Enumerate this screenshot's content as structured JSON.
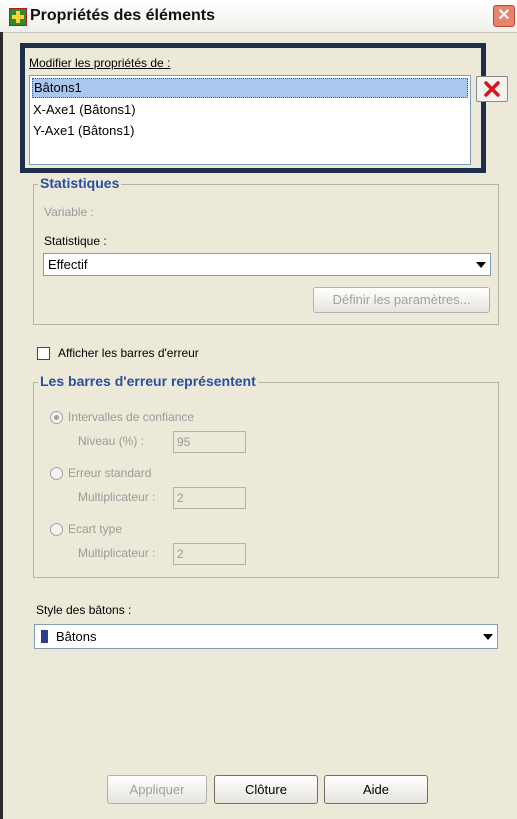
{
  "window": {
    "title": "Propriétés des éléments",
    "close_glyph": "✕"
  },
  "modify": {
    "label": "Modifier les propriétés de :",
    "items": [
      "Bâtons1",
      "X-Axe1 (Bâtons1)",
      "Y-Axe1 (Bâtons1)"
    ],
    "selected_index": 0
  },
  "statistics": {
    "legend": "Statistiques",
    "variable_label": "Variable :",
    "statistic_label": "Statistique :",
    "statistic_value": "Effectif",
    "params_button": "Définir les paramètres..."
  },
  "error_bars": {
    "checkbox_label": "Afficher les barres d'erreur",
    "checked": false,
    "legend": "Les barres d'erreur représentent",
    "options": [
      {
        "label": "Intervalles de confiance",
        "field_label": "Niveau (%) :",
        "value": "95",
        "selected": true
      },
      {
        "label": "Erreur standard",
        "field_label": "Multiplicateur :",
        "value": "2",
        "selected": false
      },
      {
        "label": "Ecart type",
        "field_label": "Multiplicateur :",
        "value": "2",
        "selected": false
      }
    ]
  },
  "style": {
    "label": "Style des bâtons :",
    "value": "Bâtons",
    "icon_color": "#2a3e8c"
  },
  "buttons": {
    "apply": "Appliquer",
    "close": "Clôture",
    "help": "Aide"
  },
  "colors": {
    "highlight_border": "#1d2e4b",
    "legend_text": "#2a4f9e",
    "delete_icon": "#d8141c"
  }
}
